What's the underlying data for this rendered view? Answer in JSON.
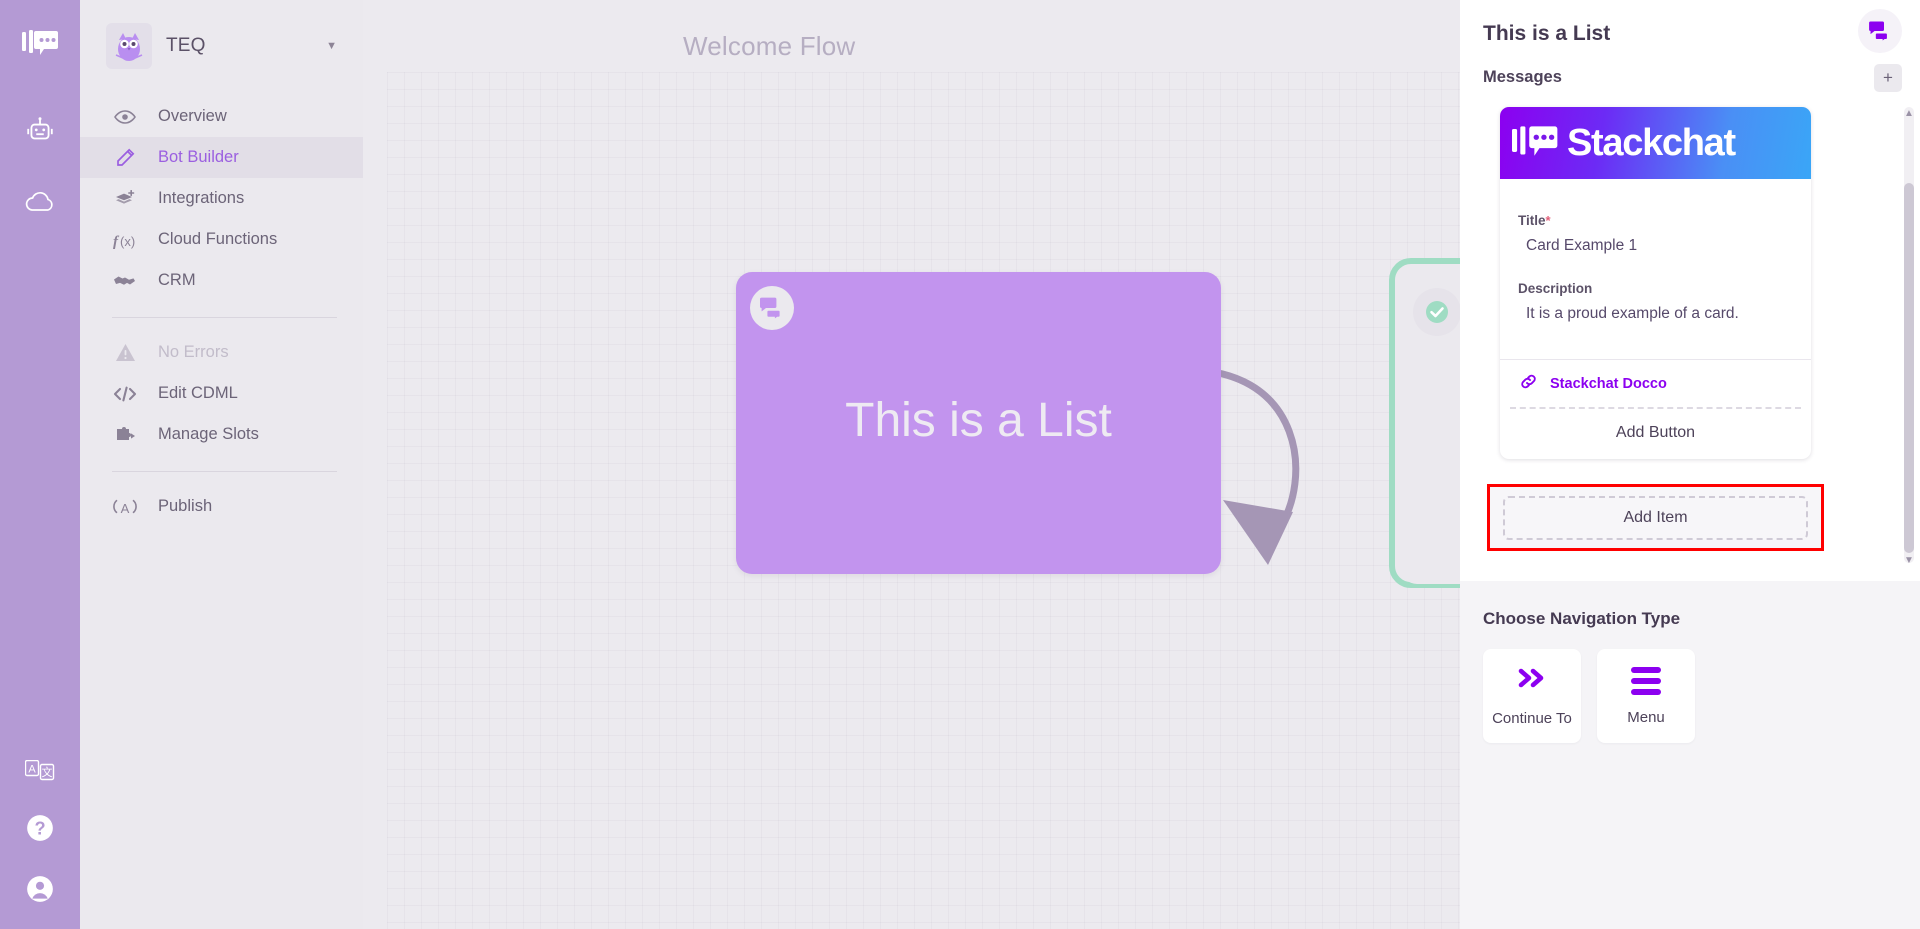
{
  "rail": {
    "logo_icon": "stackchat-logo-icon",
    "items": [
      {
        "icon": "robot-icon",
        "name": "bots"
      },
      {
        "icon": "cloud-icon",
        "name": "cloud"
      }
    ],
    "bottom": [
      {
        "icon": "translate-icon",
        "name": "language"
      },
      {
        "icon": "help-icon",
        "name": "help"
      },
      {
        "icon": "account-icon",
        "name": "account"
      }
    ]
  },
  "sidebar": {
    "brand": {
      "name": "TEQ",
      "avatar_icon": "owl-avatar-icon",
      "caret_icon": "chevron-down-icon"
    },
    "items": [
      {
        "label": "Overview",
        "icon": "eye-icon",
        "active": false,
        "muted": false
      },
      {
        "label": "Bot Builder",
        "icon": "pencil-icon",
        "active": true,
        "muted": false
      },
      {
        "label": "Integrations",
        "icon": "layers-add-icon",
        "active": false,
        "muted": false
      },
      {
        "label": "Cloud Functions",
        "icon": "function-icon",
        "active": false,
        "muted": false
      },
      {
        "label": "CRM",
        "icon": "handshake-icon",
        "active": false,
        "muted": false
      },
      {
        "label": "No Errors",
        "icon": "warning-icon",
        "active": false,
        "muted": true
      },
      {
        "label": "Edit CDML",
        "icon": "code-icon",
        "active": false,
        "muted": false
      },
      {
        "label": "Manage Slots",
        "icon": "puzzle-icon",
        "active": false,
        "muted": false
      },
      {
        "label": "Publish",
        "icon": "broadcast-icon",
        "active": false,
        "muted": false
      }
    ]
  },
  "canvas": {
    "flow_title": "Welcome Flow",
    "purple_node": {
      "label": "This is a List",
      "badge_icon": "chat-bubbles-icon",
      "color": "#c294ee"
    },
    "green_node": {
      "check_icon": "check-circle-icon",
      "border_color": "#9fdcc3"
    },
    "connector_color": "#a596b5"
  },
  "panel": {
    "title": "This is a List",
    "chat_icon": "chat-bubbles-icon",
    "messages_label": "Messages",
    "add_message_icon": "plus-icon",
    "scroll_up_icon": "caret-up-icon",
    "scroll_down_icon": "caret-down-icon",
    "card": {
      "banner_logo_icon": "stackchat-logo-icon",
      "banner_text": "Stackchat",
      "title_label": "Title",
      "title_required": "*",
      "title_value": "Card Example 1",
      "description_label": "Description",
      "description_value": "It is a proud example of a card.",
      "link_icon": "link-icon",
      "link_label": "Stackchat Docco",
      "add_button_label": "Add Button"
    },
    "add_item_label": "Add Item",
    "add_item_highlight_color": "#ff0000",
    "navigation": {
      "heading": "Choose Navigation Type",
      "tiles": [
        {
          "label": "Continue To",
          "icon": "double-chevron-right-icon"
        },
        {
          "label": "Menu",
          "icon": "hamburger-menu-icon"
        }
      ]
    }
  }
}
